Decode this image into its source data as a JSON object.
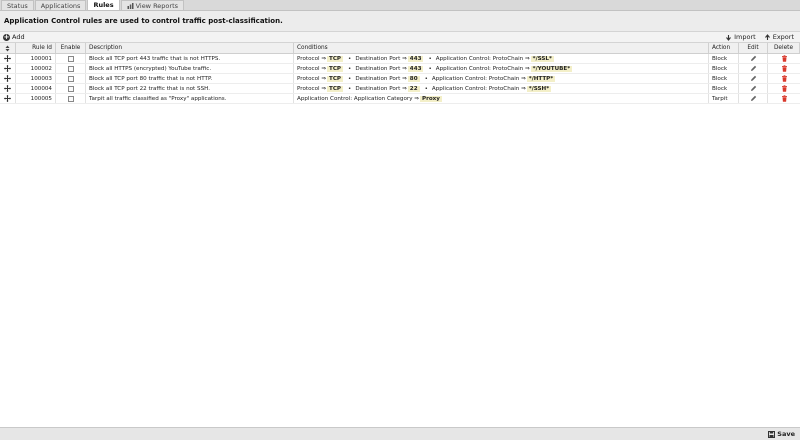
{
  "tabs": [
    {
      "label": "Status",
      "active": false
    },
    {
      "label": "Applications",
      "active": false
    },
    {
      "label": "Rules",
      "active": true
    },
    {
      "label": "View Reports",
      "active": false,
      "icon": "chart-icon"
    }
  ],
  "description": "Application Control rules are used to control traffic post-classification.",
  "toolbar": {
    "add_label": "Add",
    "import_label": "Import",
    "export_label": "Export"
  },
  "columns": {
    "rule_id": "Rule Id",
    "enable": "Enable",
    "description": "Description",
    "conditions": "Conditions",
    "action": "Action",
    "edit": "Edit",
    "delete": "Delete"
  },
  "rules": [
    {
      "id": "100001",
      "enabled": false,
      "description": "Block all TCP port 443 traffic that is not HTTPS.",
      "conditions": [
        {
          "label": "Protocol ⇒",
          "value": "TCP"
        },
        {
          "label": "Destination Port ⇒",
          "value": "443"
        },
        {
          "label": "Application Control: ProtoChain ⇒",
          "value": "*/SSL*"
        }
      ],
      "action": "Block"
    },
    {
      "id": "100002",
      "enabled": false,
      "description": "Block all HTTPS (encrypted) YouTube traffic.",
      "conditions": [
        {
          "label": "Protocol ⇒",
          "value": "TCP"
        },
        {
          "label": "Destination Port ⇒",
          "value": "443"
        },
        {
          "label": "Application Control: ProtoChain ⇒",
          "value": "*/YOUTUBE*"
        }
      ],
      "action": "Block"
    },
    {
      "id": "100003",
      "enabled": false,
      "description": "Block all TCP port 80 traffic that is not HTTP.",
      "conditions": [
        {
          "label": "Protocol ⇒",
          "value": "TCP"
        },
        {
          "label": "Destination Port ⇒",
          "value": "80"
        },
        {
          "label": "Application Control: ProtoChain ⇒",
          "value": "*/HTTP*"
        }
      ],
      "action": "Block"
    },
    {
      "id": "100004",
      "enabled": false,
      "description": "Block all TCP port 22 traffic that is not SSH.",
      "conditions": [
        {
          "label": "Protocol ⇒",
          "value": "TCP"
        },
        {
          "label": "Destination Port ⇒",
          "value": "22"
        },
        {
          "label": "Application Control: ProtoChain ⇒",
          "value": "*/SSH*"
        }
      ],
      "action": "Block"
    },
    {
      "id": "100005",
      "enabled": false,
      "description": "Tarpit all traffic classified as \"Proxy\" applications.",
      "conditions": [
        {
          "label": "Application Control: Application Category ⇒",
          "value": "Proxy"
        }
      ],
      "action": "Tarpit"
    }
  ],
  "condition_separator": "•",
  "footer": {
    "save_label": "Save"
  },
  "colors": {
    "delete_icon": "#d9382c",
    "condition_value_bg": "#f3efc8"
  }
}
